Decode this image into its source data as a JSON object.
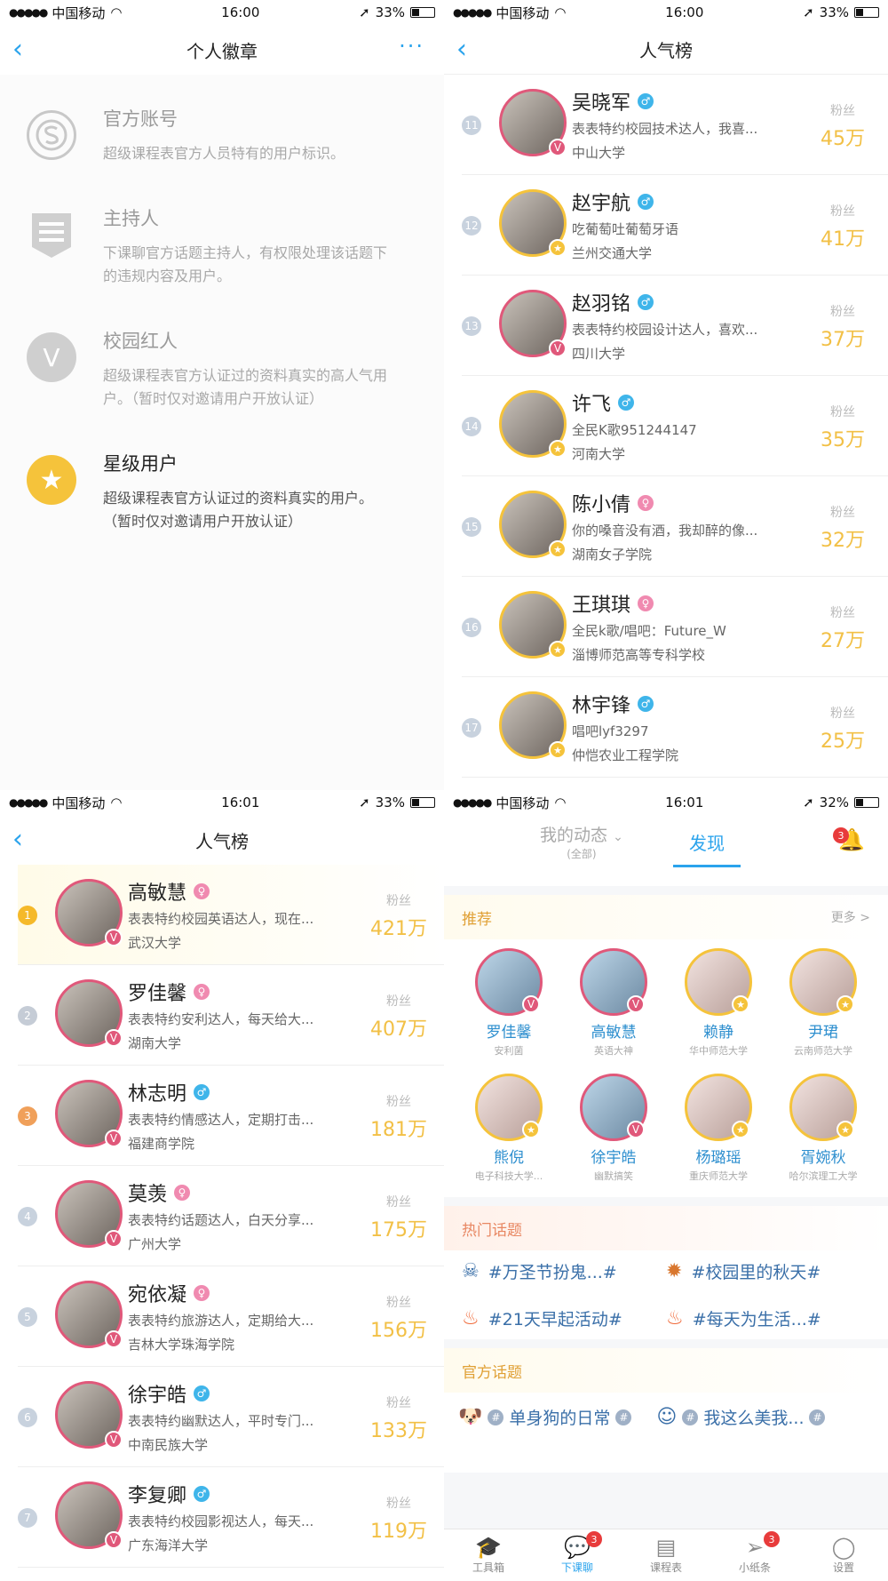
{
  "status": {
    "p1": {
      "carrier": "中国移动",
      "time": "16:00",
      "battery": "33%"
    },
    "p2": {
      "carrier": "中国移动",
      "time": "16:00",
      "battery": "33%"
    },
    "p3": {
      "carrier": "中国移动",
      "time": "16:01",
      "battery": "33%"
    },
    "p4": {
      "carrier": "中国移动",
      "time": "16:01",
      "battery": "32%"
    }
  },
  "badges_page": {
    "title": "个人徽章",
    "items": [
      {
        "title": "官方账号",
        "desc": "超级课程表官方人员特有的用户标识。"
      },
      {
        "title": "主持人",
        "desc": "下课聊官方话题主持人，有权限处理该话题下的违规内容及用户。"
      },
      {
        "title": "校园红人",
        "desc": "超级课程表官方认证过的资料真实的高人气用户。（暂时仅对邀请用户开放认证）"
      },
      {
        "title": "星级用户",
        "desc": "超级课程表官方认证过的资料真实的用户。（暂时仅对邀请用户开放认证）"
      }
    ]
  },
  "popular_a": {
    "title": "人气榜",
    "fans_label": "粉丝",
    "rows": [
      {
        "rank": "11",
        "name": "吴晓军",
        "gender": "♂",
        "bio": "表表特约校园技术达人，我喜...",
        "school": "中山大学",
        "fans": "45万"
      },
      {
        "rank": "12",
        "name": "赵宇航",
        "gender": "♂",
        "bio": "吃葡萄吐葡萄牙语",
        "school": "兰州交通大学",
        "fans": "41万"
      },
      {
        "rank": "13",
        "name": "赵羽铭",
        "gender": "♂",
        "bio": "表表特约校园设计达人，喜欢...",
        "school": "四川大学",
        "fans": "37万"
      },
      {
        "rank": "14",
        "name": "许飞",
        "gender": "♂",
        "bio": "全民K歌951244147",
        "school": "河南大学",
        "fans": "35万"
      },
      {
        "rank": "15",
        "name": "陈小倩",
        "gender": "♀",
        "bio": "你的嗓音没有酒，我却醉的像...",
        "school": "湖南女子学院",
        "fans": "32万"
      },
      {
        "rank": "16",
        "name": "王琪琪",
        "gender": "♀",
        "bio": "全民k歌/唱吧：Future_W",
        "school": "淄博师范高等专科学校",
        "fans": "27万"
      },
      {
        "rank": "17",
        "name": "林宇锋",
        "gender": "♂",
        "bio": "唱吧lyf3297",
        "school": "仲恺农业工程学院",
        "fans": "25万"
      }
    ]
  },
  "popular_b": {
    "title": "人气榜",
    "fans_label": "粉丝",
    "rows": [
      {
        "rank": "1",
        "name": "高敏慧",
        "gender": "♀",
        "bio": "表表特约校园英语达人，现在...",
        "school": "武汉大学",
        "fans": "421万"
      },
      {
        "rank": "2",
        "name": "罗佳馨",
        "gender": "♀",
        "bio": "表表特约安利达人，每天给大...",
        "school": "湖南大学",
        "fans": "407万"
      },
      {
        "rank": "3",
        "name": "林志明",
        "gender": "♂",
        "bio": "表表特约情感达人，定期打击...",
        "school": "福建商学院",
        "fans": "181万"
      },
      {
        "rank": "4",
        "name": "莫羡",
        "gender": "♀",
        "bio": "表表特约话题达人，白天分享...",
        "school": "广州大学",
        "fans": "175万"
      },
      {
        "rank": "5",
        "name": "宛依凝",
        "gender": "♀",
        "bio": "表表特约旅游达人，定期给大...",
        "school": "吉林大学珠海学院",
        "fans": "156万"
      },
      {
        "rank": "6",
        "name": "徐宇皓",
        "gender": "♂",
        "bio": "表表特约幽默达人，平时专门...",
        "school": "中南民族大学",
        "fans": "133万"
      },
      {
        "rank": "7",
        "name": "李复卿",
        "gender": "♂",
        "bio": "表表特约校园影视达人，每天...",
        "school": "广东海洋大学",
        "fans": "119万"
      }
    ]
  },
  "discover": {
    "mine_label": "我的动态",
    "mine_sub": "(全部)",
    "find_label": "发现",
    "bell_count": "3",
    "recommend_title": "推荐",
    "more_label": "更多 >",
    "recommend": [
      {
        "name": "罗佳馨",
        "sub": "安利菌"
      },
      {
        "name": "高敏慧",
        "sub": "英语大神"
      },
      {
        "name": "赖静",
        "sub": "华中师范大学"
      },
      {
        "name": "尹珺",
        "sub": "云南师范大学"
      },
      {
        "name": "熊倪",
        "sub": "电子科技大学..."
      },
      {
        "name": "徐宇皓",
        "sub": "幽默搞笑"
      },
      {
        "name": "杨璐瑶",
        "sub": "重庆师范大学"
      },
      {
        "name": "胥婉秋",
        "sub": "哈尔滨理工大学"
      }
    ],
    "hot_title": "热门话题",
    "hot_topics": [
      "#万圣节扮鬼...#",
      "#校园里的秋天#",
      "#21天早起活动#",
      "#每天为生活...#"
    ],
    "official_title": "官方话题",
    "official_topics": [
      "单身狗的日常",
      "我这么美我..."
    ],
    "tabs": [
      {
        "label": "工具箱",
        "badge": ""
      },
      {
        "label": "下课聊",
        "badge": "3"
      },
      {
        "label": "课程表",
        "badge": ""
      },
      {
        "label": "小纸条",
        "badge": "3"
      },
      {
        "label": "设置",
        "badge": ""
      }
    ]
  }
}
